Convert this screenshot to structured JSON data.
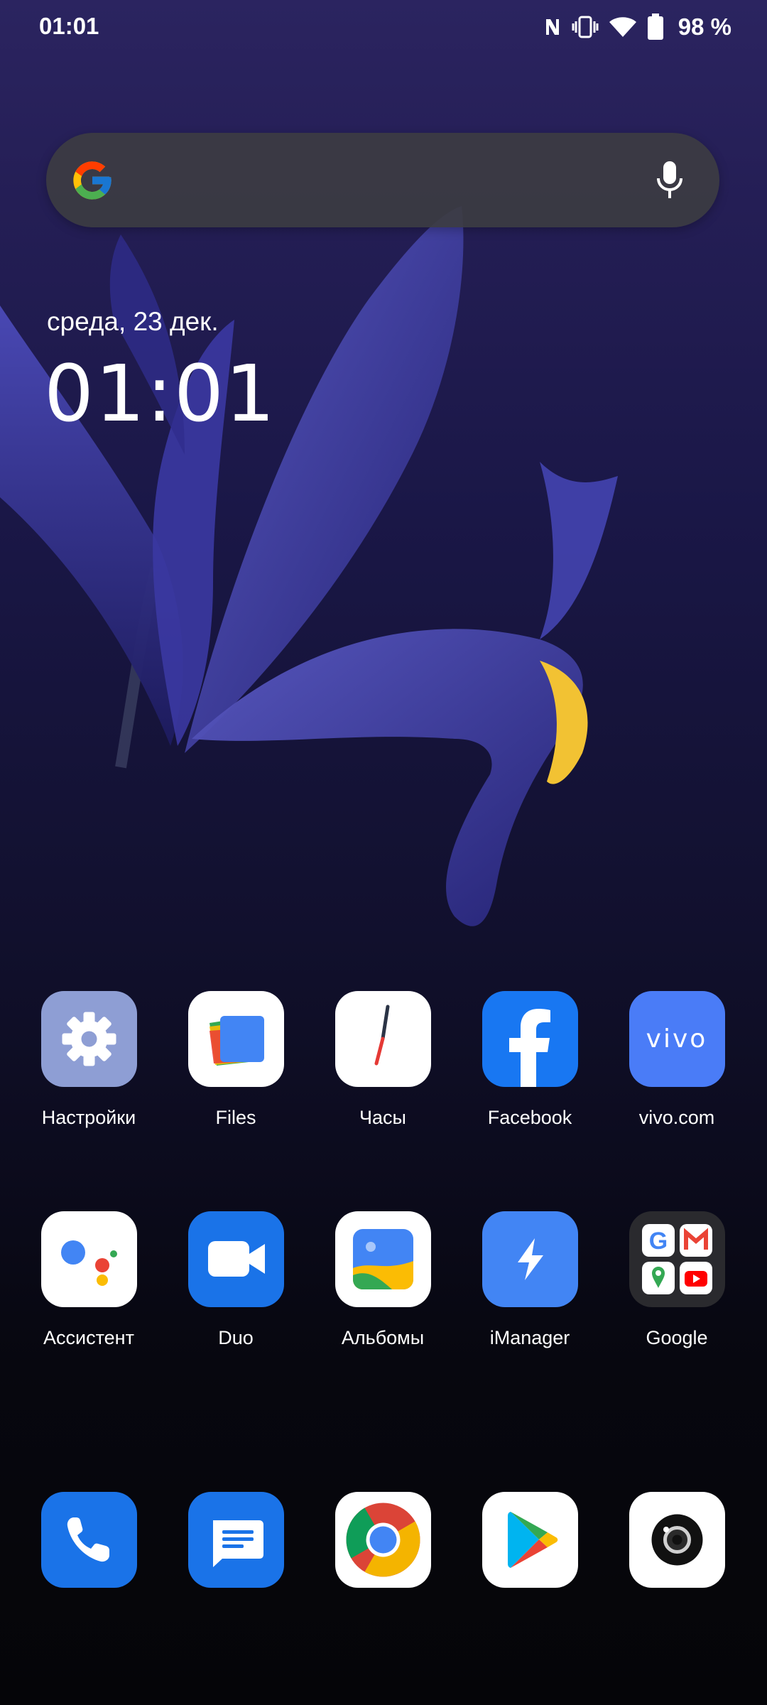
{
  "status_bar": {
    "time": "01:01",
    "battery_percent": "98 %",
    "icons": [
      "nfc-icon",
      "vibrate-icon",
      "wifi-icon",
      "battery-icon"
    ]
  },
  "search_bar": {
    "logo": "google-g-icon",
    "mic": "mic-icon"
  },
  "clock_widget": {
    "date": "среда, 23 дек.",
    "time": "01:01"
  },
  "apps_row1": [
    {
      "label": "Настройки",
      "icon": "settings-gear-icon"
    },
    {
      "label": "Files",
      "icon": "files-icon"
    },
    {
      "label": "Часы",
      "icon": "clock-icon"
    },
    {
      "label": "Facebook",
      "icon": "facebook-icon"
    },
    {
      "label": "vivo.com",
      "icon": "vivo-icon",
      "icon_text": "vivo"
    }
  ],
  "apps_row2": [
    {
      "label": "Ассистент",
      "icon": "assistant-icon"
    },
    {
      "label": "Duo",
      "icon": "duo-camera-icon"
    },
    {
      "label": "Альбомы",
      "icon": "albums-icon"
    },
    {
      "label": "iManager",
      "icon": "imanager-bolt-icon"
    },
    {
      "label": "Google",
      "icon": "google-folder-icon"
    }
  ],
  "dock": [
    {
      "icon": "phone-icon"
    },
    {
      "icon": "messages-icon"
    },
    {
      "icon": "chrome-icon"
    },
    {
      "icon": "play-store-icon"
    },
    {
      "icon": "camera-icon"
    }
  ],
  "colors": {
    "settings_bg": "#8e9ed4",
    "facebook_blue": "#1877f2",
    "vivo_blue": "#4a7cf7",
    "duo_blue": "#1a73e8",
    "imanager_blue": "#4285f4",
    "phone_blue": "#1a73e8"
  }
}
